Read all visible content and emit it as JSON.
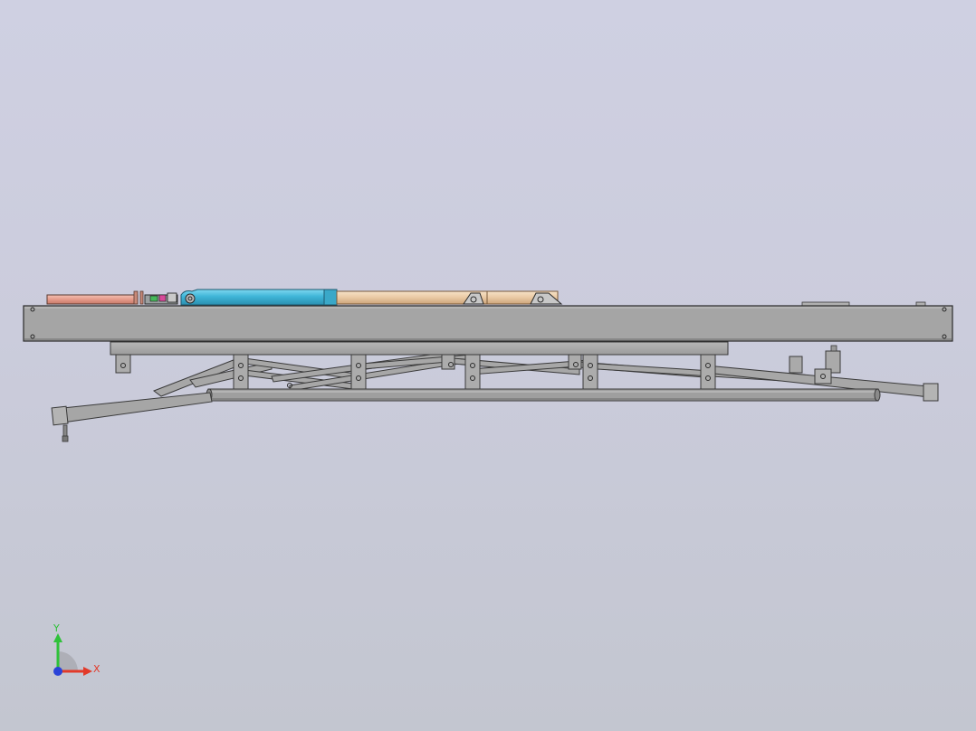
{
  "viewport": {
    "background_top": "#cfd0e2",
    "background_bottom": "#c3c6d0"
  },
  "model": {
    "frame_color": "#a4a4a4",
    "frame_edge_color": "#3a3a3a",
    "actuator_colors": {
      "red_rod": "#e59a8a",
      "blue_cylinder": "#3fb6d8",
      "tan_cylinder": "#e9c9a3"
    }
  },
  "triad": {
    "x_label": "X",
    "y_label": "Y",
    "x_color": "#e23a2a",
    "y_color": "#2fc23a",
    "z_color": "#2a43d8"
  }
}
